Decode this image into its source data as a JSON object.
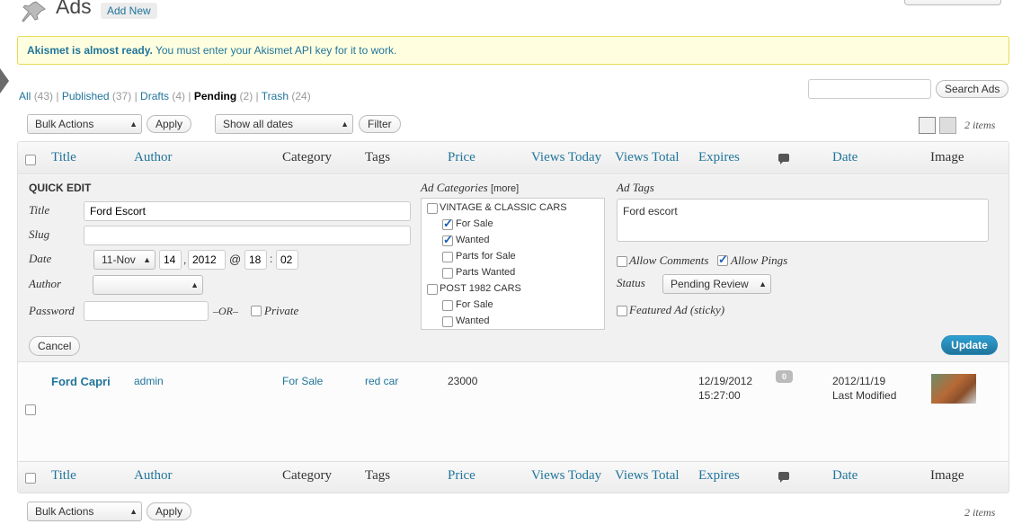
{
  "header": {
    "title": "Ads",
    "add_new": "Add New"
  },
  "notice": {
    "bold": "Akismet is almost ready.",
    "message": " You must enter your Akismet API key for it to work."
  },
  "filters": [
    {
      "label": "All",
      "count": "(43)"
    },
    {
      "label": "Published",
      "count": "(37)"
    },
    {
      "label": "Drafts",
      "count": "(4)"
    },
    {
      "label": "Pending",
      "count": "(2)"
    },
    {
      "label": "Trash",
      "count": "(24)"
    }
  ],
  "search": {
    "button": "Search Ads",
    "placeholder": ""
  },
  "toolbar": {
    "bulk_actions": "Bulk Actions",
    "apply": "Apply",
    "dates": "Show all dates",
    "filter": "Filter",
    "items": "2 items"
  },
  "columns": [
    "Title",
    "Author",
    "Category",
    "Tags",
    "Price",
    "Views Today",
    "Views Total",
    "Expires",
    "Date",
    "Image"
  ],
  "quick_edit": {
    "heading": "QUICK EDIT",
    "title_label": "Title",
    "title_value": "Ford Escort",
    "slug_label": "Slug",
    "date_label": "Date",
    "month": "11-Nov",
    "day": "14",
    "year": "2012",
    "at": "@",
    "hour": "18",
    "colon": ":",
    "minute": "02",
    "author_label": "Author",
    "password_label": "Password",
    "or": "–OR–",
    "private": "Private",
    "cat_label": "Ad Categories",
    "more": "[more]",
    "categories": [
      {
        "name": "VINTAGE & CLASSIC CARS",
        "checked": false,
        "level": 0
      },
      {
        "name": "For Sale",
        "checked": true,
        "level": 1
      },
      {
        "name": "Wanted",
        "checked": true,
        "level": 1
      },
      {
        "name": "Parts for Sale",
        "checked": false,
        "level": 1
      },
      {
        "name": "Parts Wanted",
        "checked": false,
        "level": 1
      },
      {
        "name": "POST 1982 CARS",
        "checked": false,
        "level": 0
      },
      {
        "name": "For Sale",
        "checked": false,
        "level": 1
      },
      {
        "name": "Wanted",
        "checked": false,
        "level": 1
      }
    ],
    "tags_label": "Ad Tags",
    "tags_value": "Ford escort",
    "allow_comments": "Allow Comments",
    "allow_pings": "Allow Pings",
    "status_label": "Status",
    "status_value": "Pending Review",
    "featured": "Featured Ad (sticky)",
    "cancel": "Cancel",
    "update": "Update"
  },
  "row": {
    "title": "Ford Capri",
    "author": "admin",
    "category": "For Sale",
    "tags": "red car",
    "price": "23000",
    "expires_date": "12/19/2012",
    "expires_time": "15:27:00",
    "comments": "0",
    "date": "2012/11/19",
    "date_status": "Last Modified"
  },
  "colors": {
    "link": "#21759b",
    "notice_bg": "#ffffe0",
    "update_btn": "#21759b"
  }
}
